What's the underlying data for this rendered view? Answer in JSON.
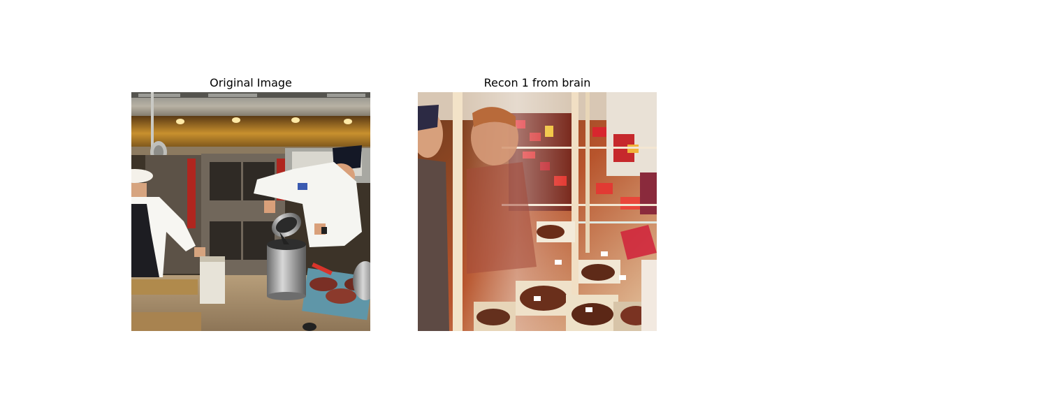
{
  "figure": {
    "panels": [
      {
        "title": "Original Image",
        "subject": "professional kitchen: two chefs in white jackets, one pouring from a steel pot into a stock pot; stainless hood with lights, ovens, and a tray of sliced roast meat on the counter"
      },
      {
        "title": "Recon 1 from brain",
        "subject": "people looking into a glass display case filled with chocolates and red gift boxes on glass shelves"
      }
    ]
  }
}
